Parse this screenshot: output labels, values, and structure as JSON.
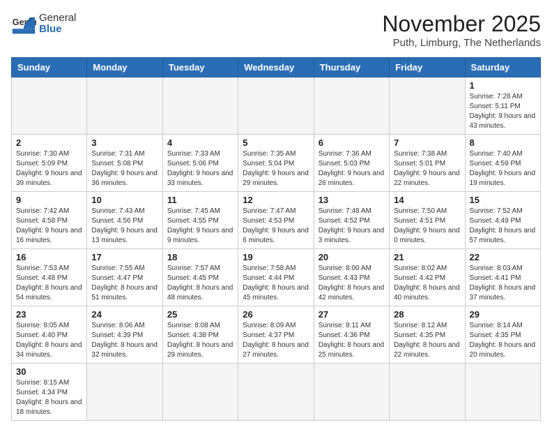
{
  "header": {
    "logo_general": "General",
    "logo_blue": "Blue",
    "month_title": "November 2025",
    "location": "Puth, Limburg, The Netherlands"
  },
  "columns": [
    "Sunday",
    "Monday",
    "Tuesday",
    "Wednesday",
    "Thursday",
    "Friday",
    "Saturday"
  ],
  "weeks": [
    [
      {
        "day": "",
        "info": ""
      },
      {
        "day": "",
        "info": ""
      },
      {
        "day": "",
        "info": ""
      },
      {
        "day": "",
        "info": ""
      },
      {
        "day": "",
        "info": ""
      },
      {
        "day": "",
        "info": ""
      },
      {
        "day": "1",
        "info": "Sunrise: 7:28 AM\nSunset: 5:11 PM\nDaylight: 9 hours and 43 minutes."
      }
    ],
    [
      {
        "day": "2",
        "info": "Sunrise: 7:30 AM\nSunset: 5:09 PM\nDaylight: 9 hours and 39 minutes."
      },
      {
        "day": "3",
        "info": "Sunrise: 7:31 AM\nSunset: 5:08 PM\nDaylight: 9 hours and 36 minutes."
      },
      {
        "day": "4",
        "info": "Sunrise: 7:33 AM\nSunset: 5:06 PM\nDaylight: 9 hours and 33 minutes."
      },
      {
        "day": "5",
        "info": "Sunrise: 7:35 AM\nSunset: 5:04 PM\nDaylight: 9 hours and 29 minutes."
      },
      {
        "day": "6",
        "info": "Sunrise: 7:36 AM\nSunset: 5:03 PM\nDaylight: 9 hours and 26 minutes."
      },
      {
        "day": "7",
        "info": "Sunrise: 7:38 AM\nSunset: 5:01 PM\nDaylight: 9 hours and 22 minutes."
      },
      {
        "day": "8",
        "info": "Sunrise: 7:40 AM\nSunset: 4:59 PM\nDaylight: 9 hours and 19 minutes."
      }
    ],
    [
      {
        "day": "9",
        "info": "Sunrise: 7:42 AM\nSunset: 4:58 PM\nDaylight: 9 hours and 16 minutes."
      },
      {
        "day": "10",
        "info": "Sunrise: 7:43 AM\nSunset: 4:56 PM\nDaylight: 9 hours and 13 minutes."
      },
      {
        "day": "11",
        "info": "Sunrise: 7:45 AM\nSunset: 4:55 PM\nDaylight: 9 hours and 9 minutes."
      },
      {
        "day": "12",
        "info": "Sunrise: 7:47 AM\nSunset: 4:53 PM\nDaylight: 9 hours and 6 minutes."
      },
      {
        "day": "13",
        "info": "Sunrise: 7:48 AM\nSunset: 4:52 PM\nDaylight: 9 hours and 3 minutes."
      },
      {
        "day": "14",
        "info": "Sunrise: 7:50 AM\nSunset: 4:51 PM\nDaylight: 9 hours and 0 minutes."
      },
      {
        "day": "15",
        "info": "Sunrise: 7:52 AM\nSunset: 4:49 PM\nDaylight: 8 hours and 57 minutes."
      }
    ],
    [
      {
        "day": "16",
        "info": "Sunrise: 7:53 AM\nSunset: 4:48 PM\nDaylight: 8 hours and 54 minutes."
      },
      {
        "day": "17",
        "info": "Sunrise: 7:55 AM\nSunset: 4:47 PM\nDaylight: 8 hours and 51 minutes."
      },
      {
        "day": "18",
        "info": "Sunrise: 7:57 AM\nSunset: 4:45 PM\nDaylight: 8 hours and 48 minutes."
      },
      {
        "day": "19",
        "info": "Sunrise: 7:58 AM\nSunset: 4:44 PM\nDaylight: 8 hours and 45 minutes."
      },
      {
        "day": "20",
        "info": "Sunrise: 8:00 AM\nSunset: 4:43 PM\nDaylight: 8 hours and 42 minutes."
      },
      {
        "day": "21",
        "info": "Sunrise: 8:02 AM\nSunset: 4:42 PM\nDaylight: 8 hours and 40 minutes."
      },
      {
        "day": "22",
        "info": "Sunrise: 8:03 AM\nSunset: 4:41 PM\nDaylight: 8 hours and 37 minutes."
      }
    ],
    [
      {
        "day": "23",
        "info": "Sunrise: 8:05 AM\nSunset: 4:40 PM\nDaylight: 8 hours and 34 minutes."
      },
      {
        "day": "24",
        "info": "Sunrise: 8:06 AM\nSunset: 4:39 PM\nDaylight: 8 hours and 32 minutes."
      },
      {
        "day": "25",
        "info": "Sunrise: 8:08 AM\nSunset: 4:38 PM\nDaylight: 8 hours and 29 minutes."
      },
      {
        "day": "26",
        "info": "Sunrise: 8:09 AM\nSunset: 4:37 PM\nDaylight: 8 hours and 27 minutes."
      },
      {
        "day": "27",
        "info": "Sunrise: 8:11 AM\nSunset: 4:36 PM\nDaylight: 8 hours and 25 minutes."
      },
      {
        "day": "28",
        "info": "Sunrise: 8:12 AM\nSunset: 4:35 PM\nDaylight: 8 hours and 22 minutes."
      },
      {
        "day": "29",
        "info": "Sunrise: 8:14 AM\nSunset: 4:35 PM\nDaylight: 8 hours and 20 minutes."
      }
    ],
    [
      {
        "day": "30",
        "info": "Sunrise: 8:15 AM\nSunset: 4:34 PM\nDaylight: 8 hours and 18 minutes."
      },
      {
        "day": "",
        "info": ""
      },
      {
        "day": "",
        "info": ""
      },
      {
        "day": "",
        "info": ""
      },
      {
        "day": "",
        "info": ""
      },
      {
        "day": "",
        "info": ""
      },
      {
        "day": "",
        "info": ""
      }
    ]
  ]
}
